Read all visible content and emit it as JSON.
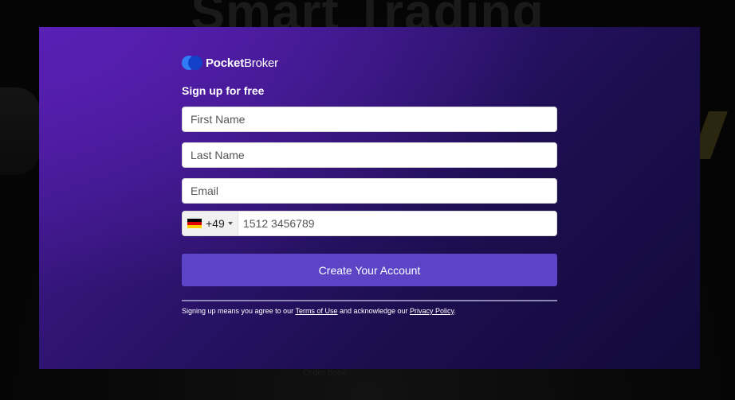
{
  "background": {
    "headline": "Smart Trading",
    "fragment": "Order book"
  },
  "brand": {
    "name_bold": "Pocket",
    "name_light": "Broker",
    "colors": {
      "logo_primary": "#2f7cf6",
      "logo_secondary": "#1240c8",
      "button": "#5b45c6",
      "modal_top": "#5a1fb5",
      "modal_bottom": "#120a3a"
    },
    "icon": "pocketbroker-logo-icon"
  },
  "form": {
    "heading": "Sign up for free",
    "first_name": {
      "placeholder": "First Name",
      "value": ""
    },
    "last_name": {
      "placeholder": "Last Name",
      "value": ""
    },
    "email": {
      "placeholder": "Email",
      "value": ""
    },
    "phone": {
      "country_flag": "germany-flag-icon",
      "dial_code": "+49",
      "placeholder": "1512 3456789",
      "value": ""
    },
    "submit_label": "Create Your Account"
  },
  "legal": {
    "prefix": "Signing up means you agree to our ",
    "terms_label": "Terms of Use",
    "middle": " and acknowledge our ",
    "privacy_label": "Privacy Policy",
    "suffix": "."
  }
}
